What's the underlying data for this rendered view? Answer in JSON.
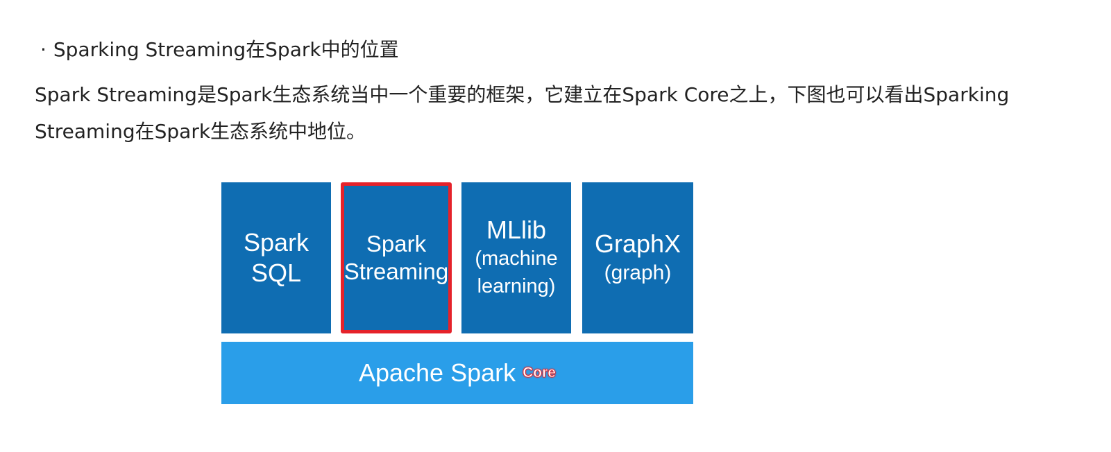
{
  "heading": {
    "bullet": "·",
    "text": "Sparking Streaming在Spark中的位置"
  },
  "paragraph": "Spark Streaming是Spark生态系统当中一个重要的框架，它建立在Spark Core之上，下图也可以看出Sparking Streaming在Spark生态系统中地位。",
  "diagram": {
    "boxes": [
      {
        "line1": "Spark",
        "line2": "SQL"
      },
      {
        "line1": "Spark",
        "line2": "Streaming"
      },
      {
        "line1": "MLlib",
        "line2": "(machine",
        "line3": "learning)"
      },
      {
        "line1": "GraphX",
        "line2": "(graph)"
      }
    ],
    "core": {
      "label": "Apache Spark",
      "annotation": "Core"
    },
    "colors": {
      "component_box": "#0f6db2",
      "core_bar": "#2a9ee9",
      "highlight_border": "#e5222a"
    }
  }
}
